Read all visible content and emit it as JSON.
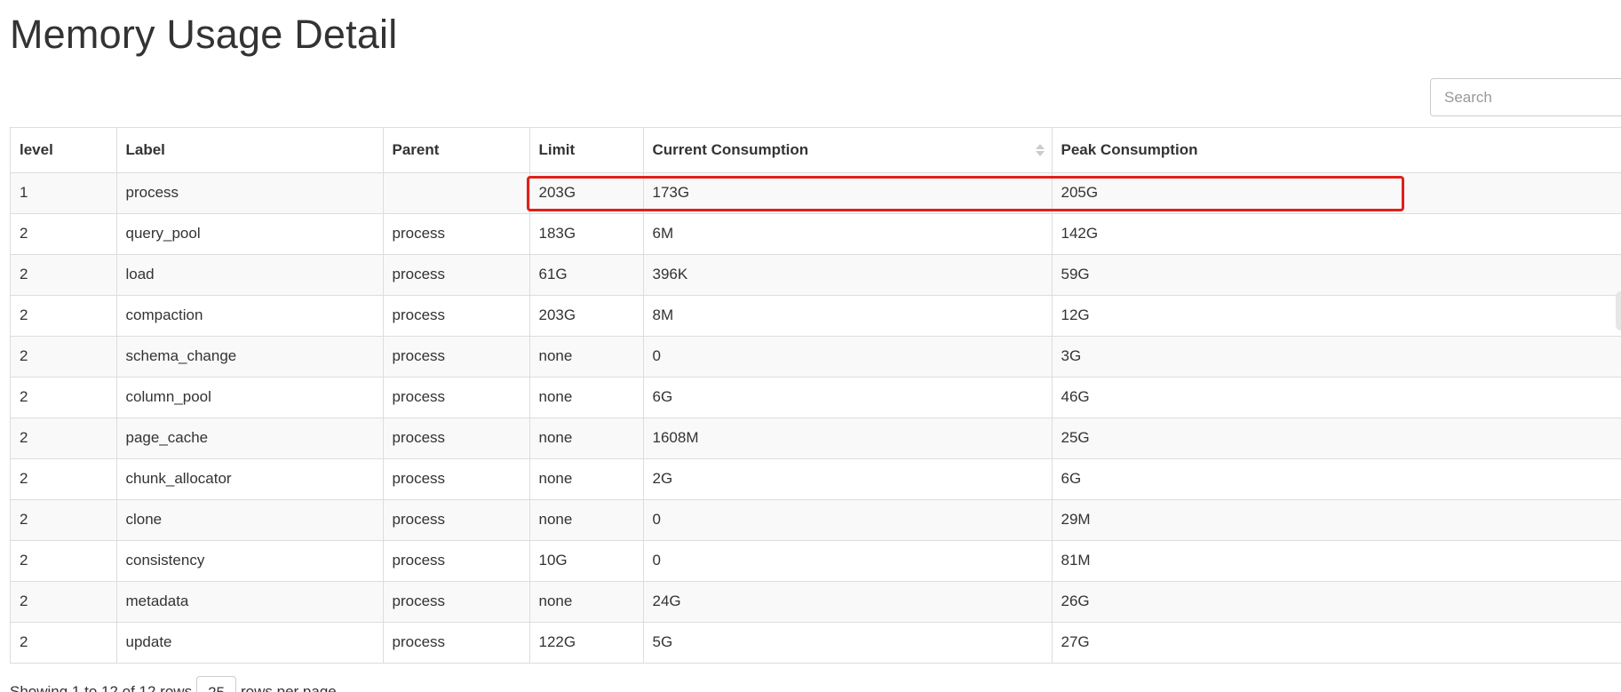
{
  "page": {
    "title": "Memory Usage Detail"
  },
  "search": {
    "placeholder": "Search",
    "value": ""
  },
  "table": {
    "columns": [
      "level",
      "Label",
      "Parent",
      "Limit",
      "Current Consumption",
      "Peak Consumption"
    ],
    "rows": [
      [
        "1",
        "process",
        "",
        "203G",
        "173G",
        "205G"
      ],
      [
        "2",
        "query_pool",
        "process",
        "183G",
        "6M",
        "142G"
      ],
      [
        "2",
        "load",
        "process",
        "61G",
        "396K",
        "59G"
      ],
      [
        "2",
        "compaction",
        "process",
        "203G",
        "8M",
        "12G"
      ],
      [
        "2",
        "schema_change",
        "process",
        "none",
        "0",
        "3G"
      ],
      [
        "2",
        "column_pool",
        "process",
        "none",
        "6G",
        "46G"
      ],
      [
        "2",
        "page_cache",
        "process",
        "none",
        "1608M",
        "25G"
      ],
      [
        "2",
        "chunk_allocator",
        "process",
        "none",
        "2G",
        "6G"
      ],
      [
        "2",
        "clone",
        "process",
        "none",
        "0",
        "29M"
      ],
      [
        "2",
        "consistency",
        "process",
        "10G",
        "0",
        "81M"
      ],
      [
        "2",
        "metadata",
        "process",
        "none",
        "24G",
        "26G"
      ],
      [
        "2",
        "update",
        "process",
        "122G",
        "5G",
        "27G"
      ]
    ]
  },
  "footer": {
    "showing_text": "Showing 1 to 12 of 12 rows",
    "page_size": "25",
    "rows_per_page_text": "rows per page"
  },
  "colors": {
    "highlight": "#e0201a",
    "border": "#dddddd",
    "stripe": "#f9f9f9"
  }
}
